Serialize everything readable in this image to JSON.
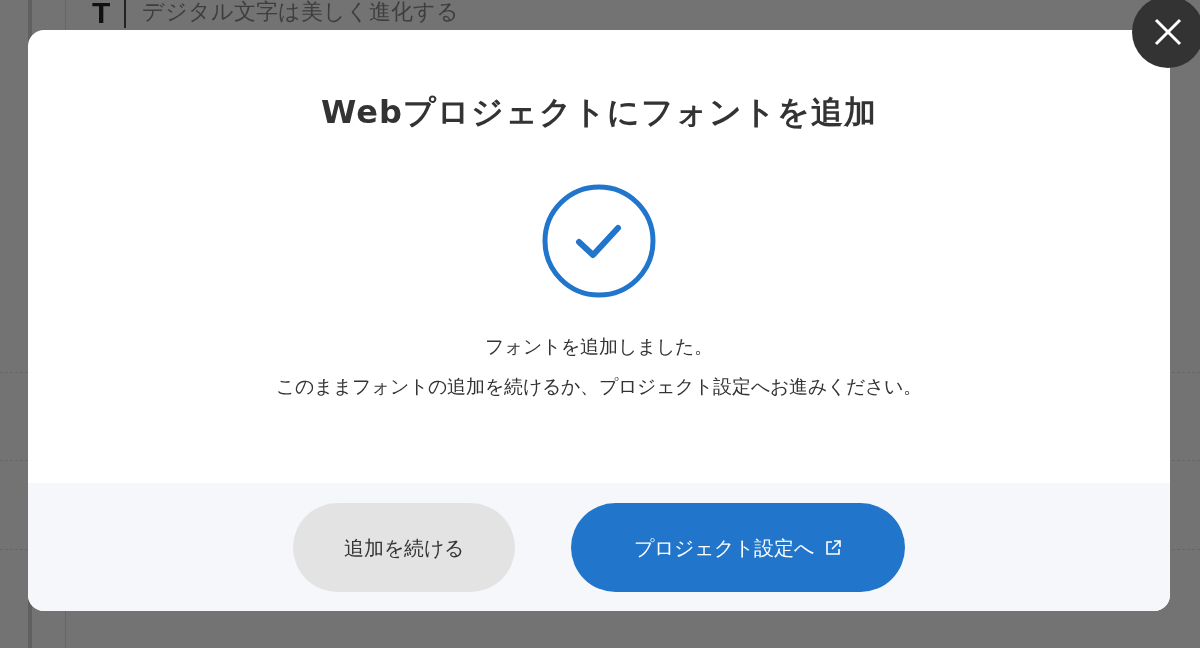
{
  "background": {
    "type_letter": "T",
    "preview_text": "デジタル文字は美しく進化する"
  },
  "dialog": {
    "title": "Webプロジェクトにフォントを追加",
    "completed": true,
    "messages": [
      "フォントを追加しました。",
      "このままフォントの追加を続けるか、プロジェクト設定へお進みください。"
    ],
    "buttons": [
      {
        "label": "追加を続ける",
        "kind": "secondary",
        "external": false
      },
      {
        "label": "プロジェクト設定へ",
        "kind": "primary",
        "external": true
      }
    ]
  }
}
